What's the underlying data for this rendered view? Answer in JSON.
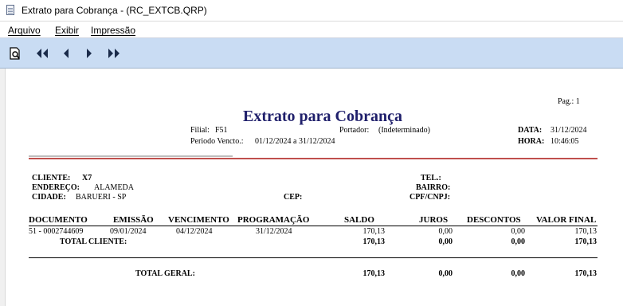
{
  "window": {
    "title": "Extrato para Cobrança - (RC_EXTCB.QRP)"
  },
  "menu": {
    "arquivo": "Arquivo",
    "exibir": "Exibir",
    "impressao": "Impressão"
  },
  "toolbar": {
    "buttons": [
      "preview-zoom-icon",
      "first-page-icon",
      "previous-page-icon",
      "next-page-icon",
      "last-page-icon"
    ]
  },
  "report": {
    "page": "Pag.: 1",
    "title": "Extrato para Cobrança",
    "filial_label": "Filial:",
    "filial_value": "F51",
    "portador_label": "Portador:",
    "portador_value": "(Indeterminado)",
    "periodo_label": "Periodo Vencto.:",
    "periodo_value": "01/12/2024 a 31/12/2024",
    "data_label": "DATA:",
    "data_value": "31/12/2024",
    "hora_label": "HORA:",
    "hora_value": "10:46:05",
    "cliente_label": "CLIENTE:",
    "cliente_value": "X7",
    "endereco_label": "ENDEREÇO:",
    "endereco_value": "ALAMEDA",
    "cidade_label": "CIDADE:",
    "cidade_value": "BARUERI - SP",
    "cep_label": "CEP:",
    "tel_label": "TEL.:",
    "bairro_label": "BAIRRO:",
    "cpf_label": "CPF/CNPJ:",
    "columns": {
      "documento": "DOCUMENTO",
      "emissao": "EMISSÃO",
      "vencimento": "VENCIMENTO",
      "programacao": "PROGRAMAÇÃO",
      "saldo": "SALDO",
      "juros": "JUROS",
      "descontos": "DESCONTOS",
      "valor_final": "VALOR FINAL"
    },
    "row": {
      "documento": "51 - 0002744609",
      "emissao": "09/01/2024",
      "vencimento": "04/12/2024",
      "programacao": "31/12/2024",
      "saldo": "170,13",
      "juros": "0,00",
      "descontos": "0,00",
      "valor_final": "170,13"
    },
    "total_cliente": {
      "label": "TOTAL CLIENTE:",
      "saldo": "170,13",
      "juros": "0,00",
      "descontos": "0,00",
      "valor_final": "170,13"
    },
    "total_geral": {
      "label": "TOTAL GERAL:",
      "saldo": "170,13",
      "juros": "0,00",
      "descontos": "0,00",
      "valor_final": "170,13"
    },
    "colors": {
      "title_blue": "#1f1f6b",
      "accent_red": "#c0504d",
      "toolbar_bg": "#c9dcf3"
    }
  }
}
